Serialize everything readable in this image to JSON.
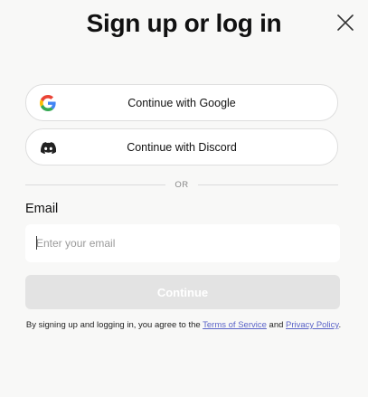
{
  "dialog": {
    "title": "Sign up or log in"
  },
  "providers": {
    "google": {
      "label": "Continue with Google",
      "icon": "google-icon"
    },
    "discord": {
      "label": "Continue with Discord",
      "icon": "discord-icon"
    }
  },
  "divider": {
    "text": "OR"
  },
  "email": {
    "label": "Email",
    "placeholder": "Enter your email",
    "value": ""
  },
  "submit": {
    "label": "Continue",
    "enabled": false
  },
  "terms": {
    "prefix": "By signing up and logging in, you agree to the ",
    "terms_link": "Terms of Service",
    "middle": " and ",
    "privacy_link": "Privacy Policy",
    "suffix": "."
  },
  "colors": {
    "background": "#f8f8f7",
    "button_border": "#dedede",
    "disabled_button": "#e3e3e3",
    "link": "#5b64c8"
  }
}
